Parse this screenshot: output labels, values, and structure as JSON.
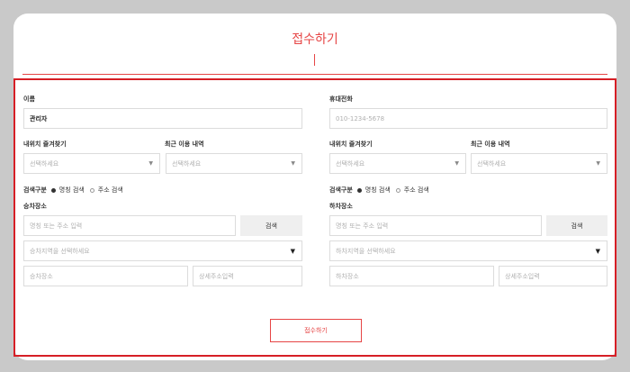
{
  "page": {
    "title": "접수하기"
  },
  "left": {
    "name_label": "이름",
    "name_value": "관리자",
    "favorites_label": "내위치 즐겨찾기",
    "favorites_value": "선택하세요",
    "recent_label": "최근 이용 내역",
    "recent_value": "선택하세요",
    "search_type_label": "검색구분",
    "radio_option_1": "명칭 검색",
    "radio_option_2": "주소 검색",
    "place_label": "승차장소",
    "place_search_placeholder": "명칭 또는 주소 입력",
    "search_button": "검색",
    "area_select_placeholder": "승차지역을 선택하세요",
    "place_input_placeholder": "승차장소",
    "detail_address_placeholder": "상세주소입력"
  },
  "right": {
    "phone_label": "휴대전화",
    "phone_placeholder": "010-1234-5678",
    "favorites_label": "내위치 즐겨찾기",
    "favorites_value": "선택하세요",
    "recent_label": "최근 이용 내역",
    "recent_value": "선택하세요",
    "search_type_label": "검색구분",
    "radio_option_1": "명칭 검색",
    "radio_option_2": "주소 검색",
    "place_label": "하차장소",
    "place_search_placeholder": "명칭 또는 주소 입력",
    "search_button": "검색",
    "area_select_placeholder": "하차지역을 선택하세요",
    "place_input_placeholder": "하차장소",
    "detail_address_placeholder": "상세주소입력"
  },
  "submit_button": "접수하기",
  "icons": {
    "dropdown": "▼",
    "radio_selected": "radio-on",
    "radio_unselected": "radio-off"
  },
  "colors": {
    "accent": "#e64545",
    "highlight_frame": "#d61f26",
    "background": "#c9c9c9"
  }
}
